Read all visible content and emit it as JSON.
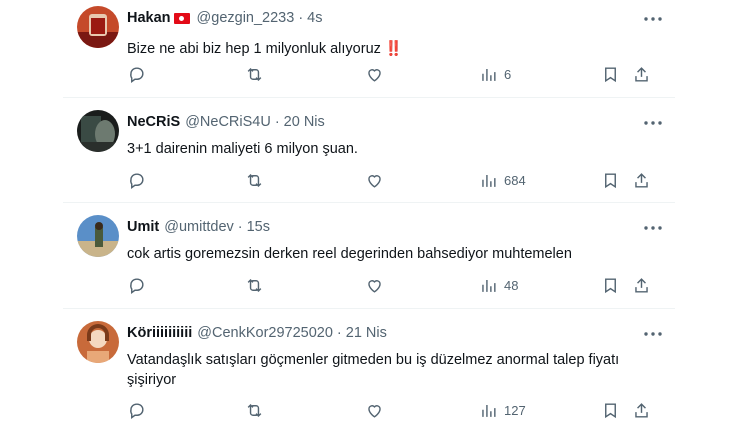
{
  "tweets": [
    {
      "name": "Hakan",
      "handle": "@gezgin_2233",
      "sep": "·",
      "time": "4s",
      "text": "Bize ne abi biz hep 1 milyonluk alıyoruz",
      "text_suffix": "‼️",
      "views": "6",
      "has_flag": true,
      "avatar_colors": [
        "#7a1812",
        "#c54a2a",
        "#e8c9b0"
      ]
    },
    {
      "name": "NeCRiS",
      "handle": "@NeCRiS4U",
      "sep": "·",
      "time": "20 Nis",
      "text": "3+1 dairenin maliyeti 6 milyon şuan.",
      "views": "684",
      "avatar_colors": [
        "#1a1d1c",
        "#3a4a44",
        "#6d7a70"
      ]
    },
    {
      "name": "Umit",
      "handle": "@umittdev",
      "sep": "·",
      "time": "15s",
      "text": "cok artis goremezsin derken reel degerinden bahsediyor muhtemelen",
      "views": "48",
      "avatar_colors": [
        "#5a8fc8",
        "#c9b48a",
        "#4a5a3a"
      ]
    },
    {
      "name": "Köriiiiiiiiii",
      "handle": "@CenkKor29725020",
      "sep": "·",
      "time": "21 Nis",
      "text": "Vatandaşlık satışları göçmenler gitmeden bu iş düzelmez anormal talep fiyatı şişiriyor",
      "views": "127",
      "avatar_colors": [
        "#c86a3a",
        "#e8a878",
        "#f4d8c0"
      ]
    }
  ]
}
